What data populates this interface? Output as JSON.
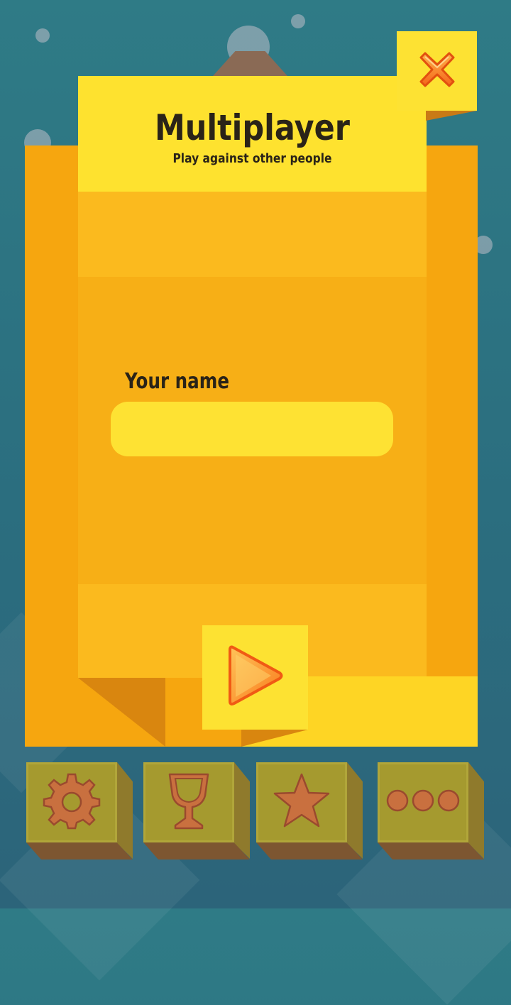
{
  "header": {
    "title": "Multiplayer",
    "subtitle": "Play against other people"
  },
  "form": {
    "name_label": "Your name",
    "name_value": "",
    "name_placeholder": ""
  },
  "buttons": {
    "close_icon": "close-x-icon",
    "play_icon": "play-triangle-icon"
  },
  "toolbar": {
    "items": [
      {
        "icon": "gear-icon"
      },
      {
        "icon": "trophy-cup-icon"
      },
      {
        "icon": "star-icon"
      },
      {
        "icon": "more-dots-icon"
      }
    ]
  },
  "colors": {
    "background": "#2f7b86",
    "panel": "#f6a60f",
    "header": "#fee22f",
    "icon_orange": "#fb7a1c",
    "toolbar_tile": "#a59a2f"
  }
}
